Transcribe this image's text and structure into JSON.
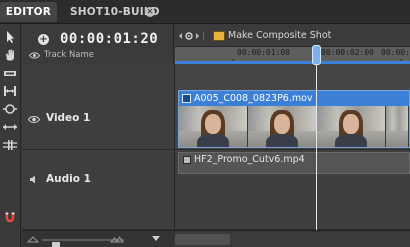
{
  "tabs": [
    {
      "label": "EDITOR",
      "active": true
    },
    {
      "label": "SHOT10-BUILD",
      "active": false
    }
  ],
  "header": {
    "timecode": "00:00:01:20",
    "track_name_label": "Track Name",
    "composite_label": "Make Composite Shot",
    "ruler_labels": [
      "00:00:01:00",
      "00:00:02:00",
      "00:00:"
    ]
  },
  "tracks": [
    {
      "name": "Video 1",
      "type": "video",
      "clip": "A005_C008_0823P6.mov"
    },
    {
      "name": "Audio 1",
      "type": "audio",
      "clip": "HF2_Promo_Cutv6.mp4"
    }
  ],
  "colors": {
    "accent": "#3c7fd6",
    "tab_active_bg": "#454545",
    "panel_bg": "#3a3a3a",
    "composite_icon": "#e8b33a",
    "magnet": "#e04a3a"
  },
  "icons": {
    "toolbar": [
      "cursor-icon",
      "hand-icon",
      "razor-icon",
      "slip-icon",
      "slide-icon",
      "ripple-icon",
      "roll-icon",
      "magnet-icon"
    ],
    "header": [
      "add-icon",
      "eye-icon",
      "gear-icon",
      "composite-shot-icon"
    ],
    "bottom": [
      "zoom-out-icon",
      "zoom-in-icon",
      "menu-arrow-icon"
    ]
  }
}
